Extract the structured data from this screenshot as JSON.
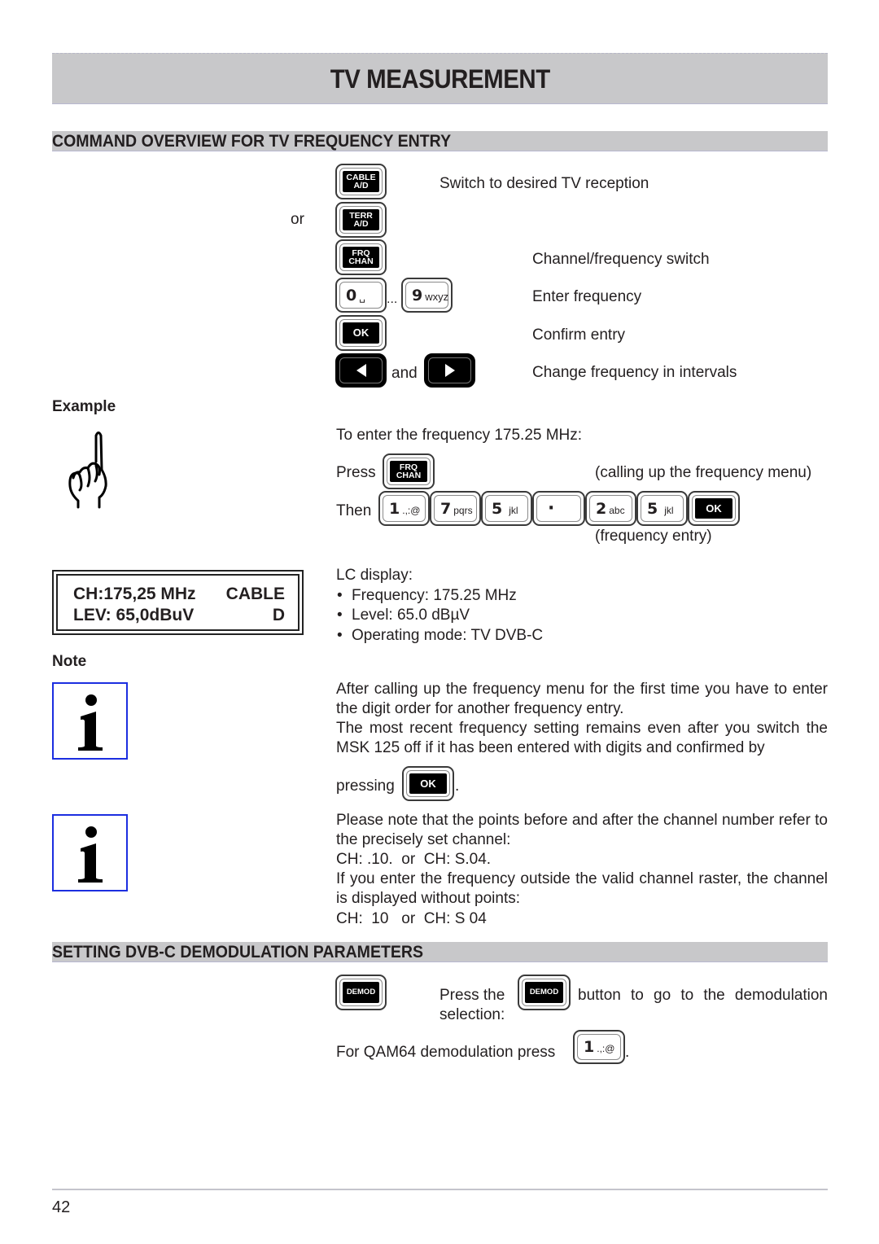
{
  "page": {
    "title": "TV MEASUREMENT",
    "page_number": "42"
  },
  "section1": {
    "heading": "COMMAND OVERVIEW FOR TV FREQUENCY ENTRY",
    "or_label": "or",
    "ellipsis": "...",
    "and_label": "and",
    "keys": {
      "cable": "CABLE A/D",
      "terr": "TERR A/D",
      "frq": "FRQ CHAN",
      "zero_digit": "0",
      "zero_sub": "␣",
      "nine_digit": "9",
      "nine_sub": "wxyz",
      "ok": "OK"
    },
    "commands": [
      "Switch to desired TV reception",
      "Channel/frequency switch",
      "Enter frequency",
      "Confirm entry",
      "Change frequency in intervals"
    ]
  },
  "example": {
    "label": "Example",
    "intro": "To enter the frequency 175.25 MHz:",
    "press_label": "Press",
    "press_key": "FRQ CHAN",
    "press_note": "(calling up the frequency menu)",
    "then_label": "Then",
    "sequence": [
      {
        "digit": "1",
        "sub": ".,:@"
      },
      {
        "digit": "7",
        "sub": "pqrs"
      },
      {
        "digit": "5",
        "sub": "jkl"
      },
      {
        "digit": "·",
        "sub": ""
      },
      {
        "digit": "2",
        "sub": "abc"
      },
      {
        "digit": "5",
        "sub": "jkl"
      },
      {
        "digit": "OK",
        "sub": ""
      }
    ],
    "sequence_note": "(frequency entry)"
  },
  "lcd": {
    "line1_left": "CH:175,25 MHz",
    "line1_right": "CABLE",
    "line2_left": "LEV: 65,0dBuV",
    "line2_right": "D"
  },
  "lc_display": {
    "label": "LC display:",
    "items": [
      "Frequency: 175.25 MHz",
      "Level: 65.0 dBµV",
      "Operating mode: TV DVB-C"
    ]
  },
  "note": {
    "label": "Note",
    "para1": "After calling up the frequency menu for the first time you have to enter the digit order for another frequency entry.",
    "para2": "The most recent frequency setting remains even after you switch the MSK 125 off if it has been entered with digits and confirmed by",
    "pressing_label": "pressing",
    "pressing_key": "OK",
    "pressing_end": ".",
    "para3": "Please note that the points before and after the channel number refer to the precisely set channel:",
    "example1": "CH: .10.  or  CH: S.04.",
    "para4": "If you enter the frequency outside the valid channel raster, the channel is displayed without points:",
    "example2": "CH:  10   or  CH: S 04"
  },
  "section2": {
    "heading": "SETTING DVB-C DEMODULATION PARAMETERS",
    "demod_key": "DEMOD",
    "press_the": "Press the",
    "press_rest": "button to go to the demodulation selection:",
    "qam_text": "For QAM64 demodulation press",
    "qam_key_digit": "1",
    "qam_key_sub": ".,:@",
    "qam_end": "."
  }
}
